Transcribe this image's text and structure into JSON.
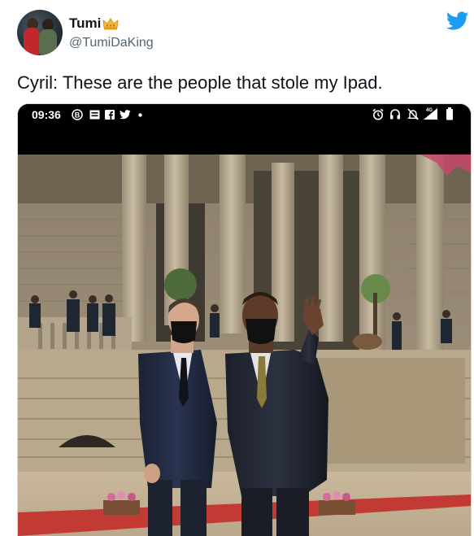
{
  "author": {
    "display_name": "Tumi",
    "handle": "@TumiDaKing",
    "verified_badge": "crown-emoji-icon"
  },
  "tweet": {
    "text": "Cyril: These are the people that stole my Ipad."
  },
  "platform": {
    "logo": "twitter-bird-icon",
    "brand_color": "#1d9bf0"
  },
  "phone_status_bar": {
    "time": "09:36",
    "left_icons": [
      "b-icon",
      "message-icon",
      "facebook-icon",
      "twitter-icon",
      "dot"
    ],
    "right_icons": [
      "alarm-icon",
      "headset-icon",
      "mute-icon",
      "signal-4g-icon",
      "battery-icon"
    ],
    "network_label": "4G"
  }
}
